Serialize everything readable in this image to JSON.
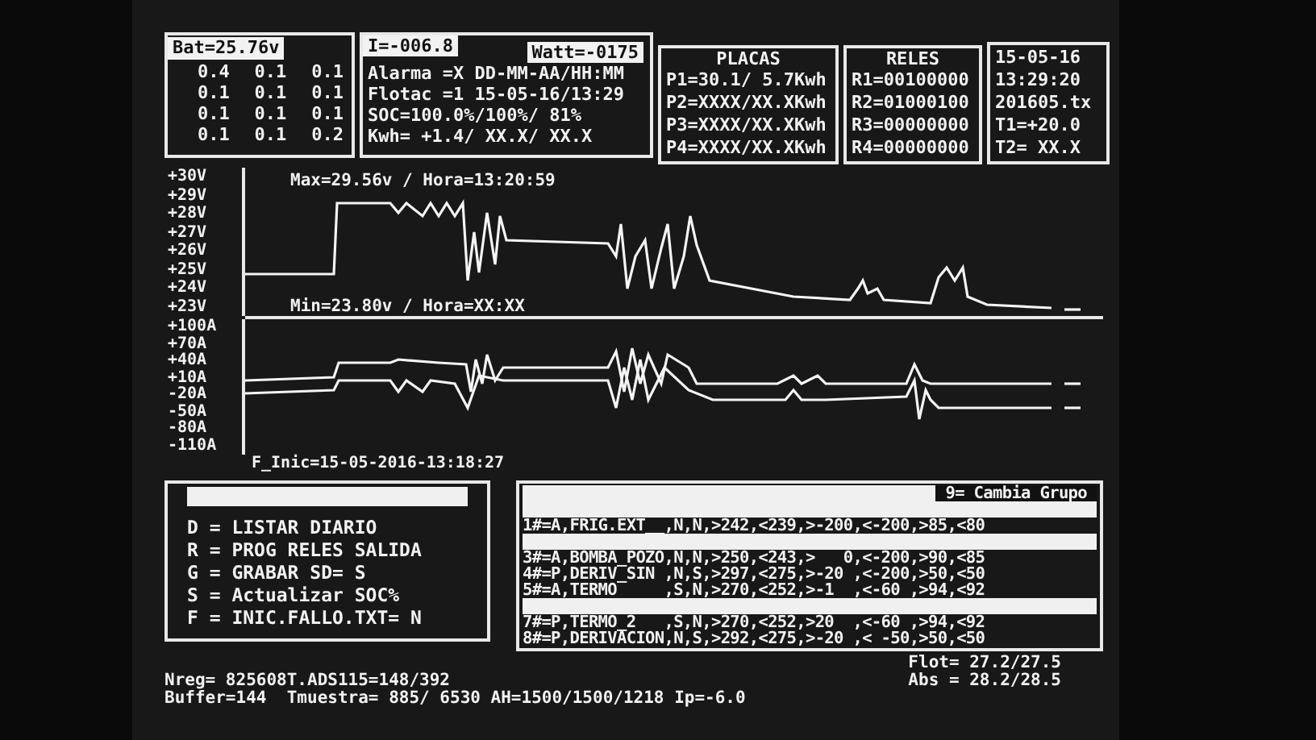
{
  "battery": {
    "header": "Bat=25.76v",
    "cells": [
      [
        "0.4",
        "0.1",
        "0.1"
      ],
      [
        "0.1",
        "0.1",
        "0.1"
      ],
      [
        "0.1",
        "0.1",
        "0.1"
      ],
      [
        "0.1",
        "0.1",
        "0.2"
      ]
    ]
  },
  "status": {
    "current": "I=-006.8",
    "power": "Watt=-0175",
    "lines": [
      "Alarma =X DD-MM-AA/HH:MM",
      "Flotac =1 15-05-16/13:29",
      "SOC=100.0%/100%/ 81%",
      "Kwh= +1.4/ XX.X/ XX.X"
    ]
  },
  "panels": {
    "title": "PLACAS",
    "lines": [
      "P1=30.1/ 5.7Kwh",
      "P2=XXXX/XX.XKwh",
      "P3=XXXX/XX.XKwh",
      "P4=XXXX/XX.XKwh"
    ]
  },
  "relays": {
    "title": "RELES",
    "lines": [
      "R1=00100000",
      "R2=01000100",
      "R3=00000000",
      "R4=00000000"
    ]
  },
  "clock": {
    "lines": [
      "15-05-16",
      "13:29:20",
      "201605.tx",
      "T1=+20.0",
      "T2= XX.X"
    ]
  },
  "voltage_chart": {
    "y_labels": [
      "+30V",
      "+29V",
      "+28V",
      "+27V",
      "+26V",
      "+25V",
      "+24V",
      "+23V"
    ],
    "max_label": "Max=29.56v / Hora=13:20:59",
    "min_label": "Min=23.80v / Hora=XX:XX"
  },
  "current_chart": {
    "y_labels": [
      "+100A",
      "+70A",
      "+40A",
      "+10A",
      "-20A",
      "-50A",
      "-80A",
      "-110A"
    ],
    "start_label": "F_Inic=15-05-2016-13:18:27"
  },
  "menu": {
    "items": [
      "D = LISTAR DIARIO",
      "R = PROG RELES SALIDA",
      "G = GRABAR SD= S",
      "S = Actualizar SOC%",
      "F = INIC.FALLO.TXT= N"
    ]
  },
  "relay_group": {
    "hint": "9= Cambia Grupo",
    "rows": [
      {
        "kind": "highlight"
      },
      {
        "kind": "text",
        "text": "1#=A,FRIG.EXT__,N,N,>242,<239,>-200,<-200,>85,<80"
      },
      {
        "kind": "highlight"
      },
      {
        "kind": "text",
        "text": "3#=A,BOMBA_POZO,N,N,>250,<243,>   0,<-200,>90,<85"
      },
      {
        "kind": "text",
        "text": "4#=P,DERIV_SIN ,N,S,>297,<275,>-20 ,<-200,>50,<50"
      },
      {
        "kind": "text",
        "text": "5#=A,TERMO     ,S,N,>270,<252,>-1  ,<-60 ,>94,<92"
      },
      {
        "kind": "highlight"
      },
      {
        "kind": "text",
        "text": "7#=P,TERMO_2   ,S,N,>270,<252,>20  ,<-60 ,>94,<92"
      },
      {
        "kind": "text",
        "text": "8#=P,DERIVACION,N,S,>292,<275,>-20 ,< -50,>50,<50"
      }
    ]
  },
  "footer": {
    "lines": [
      "Nreg= 825608T.ADS115=148/392",
      "Buffer=144  Tmuestra= 885/ 6530 AH=1500/1500/1218 Ip=-6.0"
    ],
    "side_lines": [
      "Flot= 27.2/27.5",
      "Abs = 28.2/28.5"
    ]
  }
}
